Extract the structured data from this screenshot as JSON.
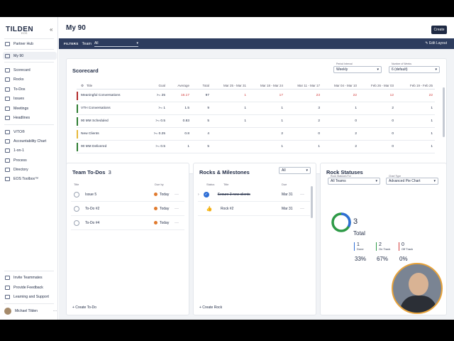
{
  "sidebar": {
    "brand": "TILDEN",
    "brand_sub": "EOS",
    "items": [
      {
        "label": "Partner Hub",
        "icon": "partner-hub-icon"
      },
      {
        "label": "My 90",
        "icon": "home-icon",
        "active": true
      },
      {
        "label": "Scorecard",
        "icon": "scorecard-icon"
      },
      {
        "label": "Rocks",
        "icon": "rocks-icon"
      },
      {
        "label": "To-Dos",
        "icon": "todos-icon"
      },
      {
        "label": "Issues",
        "icon": "issues-icon"
      },
      {
        "label": "Meetings",
        "icon": "meetings-icon"
      },
      {
        "label": "Headlines",
        "icon": "headlines-icon"
      },
      {
        "label": "V/TO®",
        "icon": "vto-icon"
      },
      {
        "label": "Accountability Chart",
        "icon": "accountability-chart-icon"
      },
      {
        "label": "1-on-1",
        "icon": "one-on-one-icon"
      },
      {
        "label": "Process",
        "icon": "process-icon"
      },
      {
        "label": "Directory",
        "icon": "directory-icon"
      },
      {
        "label": "EOS Toolbox™",
        "icon": "toolbox-icon"
      }
    ],
    "bottom_items": [
      {
        "label": "Invite Teammates"
      },
      {
        "label": "Provide Feedback"
      },
      {
        "label": "Learning and Support"
      }
    ],
    "user_name": "Michael Tilden",
    "user_more": "···"
  },
  "topbar": {
    "title": "My 90",
    "create_label": "Create"
  },
  "filterbar": {
    "filters_label": "FILTERS",
    "team_label": "Team",
    "team_value": "All",
    "edit_layout": "Edit Layout"
  },
  "scorecard": {
    "title": "Scorecard",
    "period_label": "Period Interval",
    "period_value": "Weekly",
    "weeks_label": "Number of Weeks",
    "weeks_value": "6 (default)",
    "headers": [
      "Title",
      "Goal",
      "Average",
      "Total",
      "Mar 25 - Mar 31",
      "Mar 18 - Mar 24",
      "Mar 11 - Mar 17",
      "Mar 04 - Mar 10",
      "Feb 26 - Mar 03",
      "Feb 19 - Feb 25"
    ],
    "rows": [
      {
        "title": "Meaningful Conversations",
        "goal": ">= 25",
        "average": "16.17",
        "total": "97",
        "weeks": [
          "1",
          "17",
          "23",
          "22",
          "12",
          "22"
        ],
        "color": "#b22a2a",
        "red": true
      },
      {
        "title": "VTH Conversations",
        "goal": ">= 1",
        "average": "1.5",
        "total": "9",
        "weeks": [
          "1",
          "1",
          "3",
          "1",
          "2",
          "1"
        ],
        "color": "#2e7d32",
        "red": false
      },
      {
        "title": "90 MM Scheduled",
        "goal": ">= 0.5",
        "average": "0.83",
        "total": "5",
        "weeks": [
          "1",
          "1",
          "2",
          "0",
          "0",
          "1"
        ],
        "color": "#2e7d32",
        "red": false
      },
      {
        "title": "New Clients",
        "goal": ">= 0.25",
        "average": "0.8",
        "total": "4",
        "weeks": [
          "",
          "2",
          "0",
          "2",
          "0",
          "1"
        ],
        "color": "#e6b83a",
        "red": false
      },
      {
        "title": "90 MM Delivered",
        "goal": ">= 0.5",
        "average": "1",
        "total": "5",
        "weeks": [
          "",
          "1",
          "1",
          "2",
          "0",
          "1"
        ],
        "color": "#2e7d32",
        "red": false
      }
    ]
  },
  "todos": {
    "title": "Team To-Dos",
    "count": "3",
    "col_title": "Title",
    "col_due": "Due by",
    "items": [
      {
        "title": "Issue 5",
        "due": "Today"
      },
      {
        "title": "To-Do #2",
        "due": "Today"
      },
      {
        "title": "To-Do #4",
        "due": "Today"
      }
    ],
    "create_label": "+ Create To-Do"
  },
  "rocks": {
    "title": "Rocks & Milestones",
    "filter": "All",
    "col_status": "Status",
    "col_title": "Title",
    "col_due": "Due",
    "items": [
      {
        "title": "Secure 3 new clients",
        "due": "Mar 31"
      },
      {
        "title": "Rock #2",
        "due": "Mar 31"
      }
    ],
    "create_label": "+ Create Rock"
  },
  "rock_statuses": {
    "title": "Rock Statuses",
    "statuses_for_label": "Rock Statuses For",
    "statuses_for_value": "All Teams",
    "chart_type_label": "Chart Type",
    "chart_type_value": "Advanced Pie Chart",
    "total_value": "3",
    "total_label": "Total",
    "stats": [
      {
        "value": "1",
        "label": "Done",
        "pct": "33%",
        "color": "#2f6fd6"
      },
      {
        "value": "2",
        "label": "On Track",
        "pct": "67%",
        "color": "#2e9a47"
      },
      {
        "value": "0",
        "label": "Off Track",
        "pct": "0%",
        "color": "#d23b3b"
      }
    ]
  }
}
